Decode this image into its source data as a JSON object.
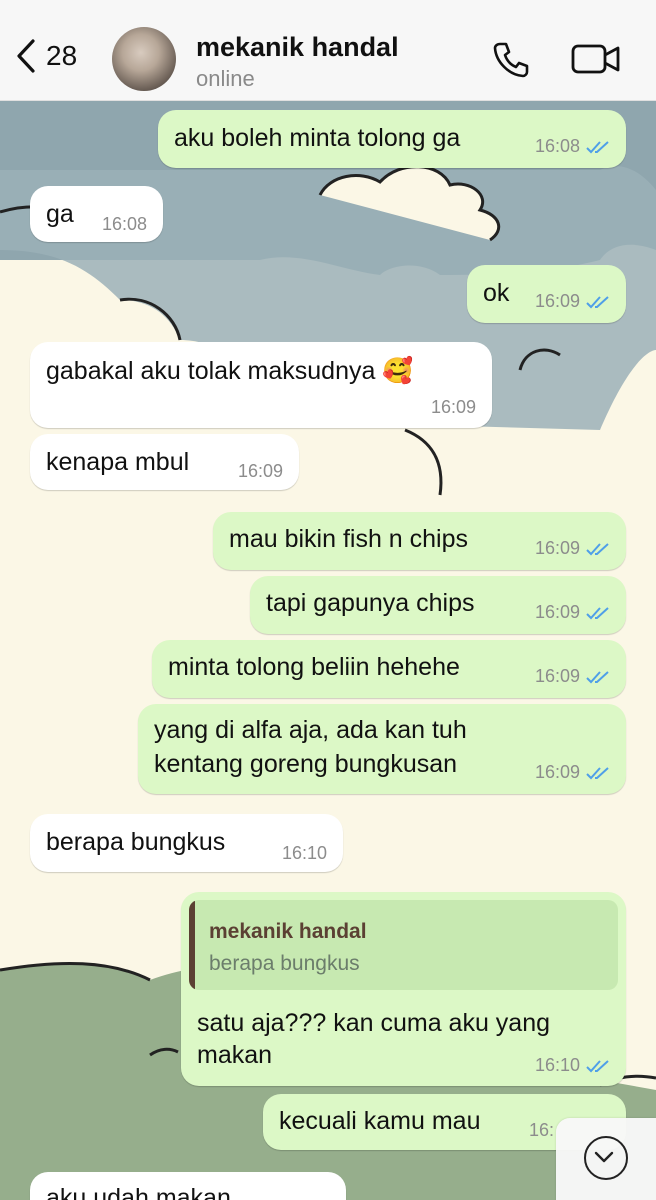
{
  "header": {
    "back_count": "28",
    "contact_name": "mekanik handal",
    "status": "online"
  },
  "messages": [
    {
      "dir": "out",
      "text": "aku boleh minta tolong ga",
      "time": "16:08"
    },
    {
      "dir": "in",
      "text": "ga",
      "time": "16:08"
    },
    {
      "dir": "out",
      "text": "ok",
      "time": "16:09"
    },
    {
      "dir": "in",
      "text": "gabakal aku tolak maksudnya 🥰",
      "time": "16:09"
    },
    {
      "dir": "in",
      "text": "kenapa mbul",
      "time": "16:09"
    },
    {
      "dir": "out",
      "text": "mau bikin fish n chips",
      "time": "16:09"
    },
    {
      "dir": "out",
      "text": "tapi gapunya chips",
      "time": "16:09"
    },
    {
      "dir": "out",
      "text": "minta tolong beliin hehehe",
      "time": "16:09"
    },
    {
      "dir": "out",
      "text_line1": "yang di alfa aja, ada kan tuh",
      "text_line2": "kentang goreng bungkusan",
      "time": "16:09"
    },
    {
      "dir": "in",
      "text": "berapa bungkus",
      "time": "16:10"
    },
    {
      "dir": "out",
      "reply_name": "mekanik handal",
      "reply_text": "berapa bungkus",
      "text_line1": "satu aja??? kan cuma aku yang",
      "text_line2": "makan",
      "time": "16:10"
    },
    {
      "dir": "out",
      "text": "kecuali kamu mau",
      "time": "16:"
    },
    {
      "dir": "in",
      "text": "aku udah makan"
    }
  ]
}
